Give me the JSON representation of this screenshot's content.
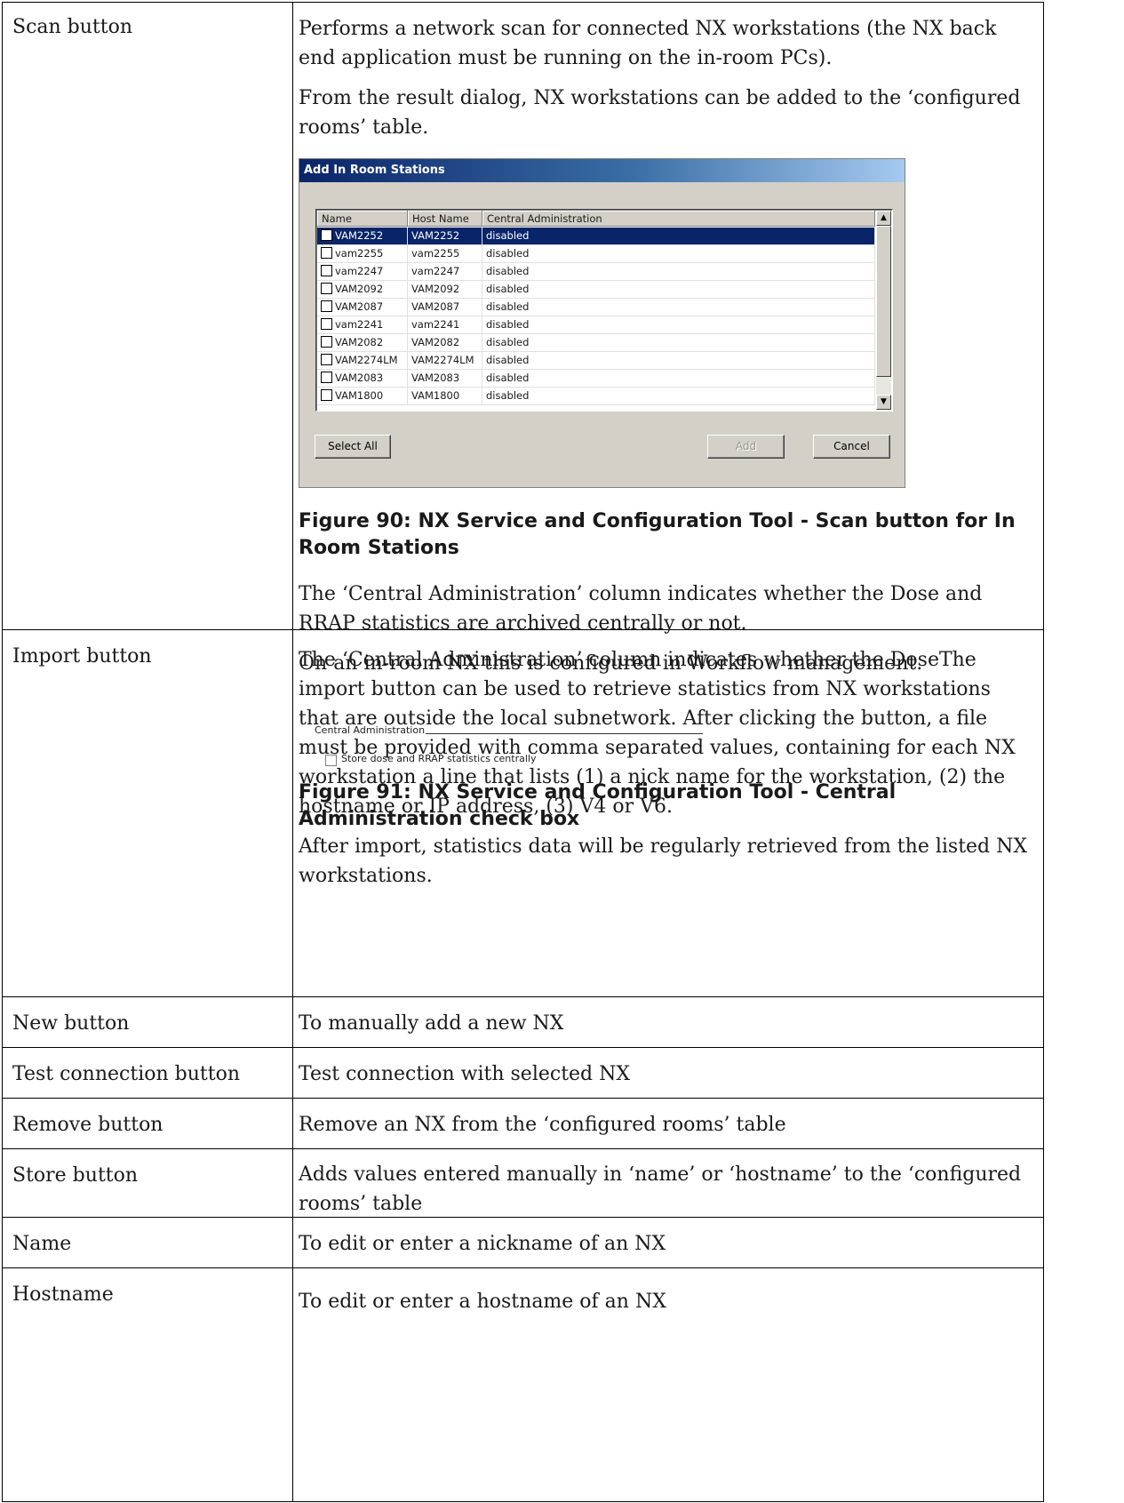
{
  "rows": [
    {
      "label": "Scan button",
      "paragraphs": [
        "Performs a network scan for connected NX workstations (the NX back end application must be running on the in-room PCs).",
        "From the result dialog, NX workstations can be added to the ‘configured rooms’ table."
      ],
      "dialog": {
        "title": "Add In Room Stations",
        "columns": [
          "Name",
          "Host Name",
          "Central Administration"
        ],
        "stations": [
          {
            "name": "VAM2252",
            "host": "VAM2252",
            "central": "disabled"
          },
          {
            "name": "vam2255",
            "host": "vam2255",
            "central": "disabled"
          },
          {
            "name": "vam2247",
            "host": "vam2247",
            "central": "disabled"
          },
          {
            "name": "VAM2092",
            "host": "VAM2092",
            "central": "disabled"
          },
          {
            "name": "VAM2087",
            "host": "VAM2087",
            "central": "disabled"
          },
          {
            "name": "vam2241",
            "host": "vam2241",
            "central": "disabled"
          },
          {
            "name": "VAM2082",
            "host": "VAM2082",
            "central": "disabled"
          },
          {
            "name": "VAM2274LM",
            "host": "VAM2274LM",
            "central": "disabled"
          },
          {
            "name": "VAM2083",
            "host": "VAM2083",
            "central": "disabled"
          },
          {
            "name": "VAM1800",
            "host": "VAM1800",
            "central": "disabled"
          }
        ],
        "selected_index": 0,
        "buttons": {
          "select_all": "Select All",
          "add": "Add",
          "cancel": "Cancel"
        }
      },
      "figure90_caption": "Figure 90: NX Service and Configuration Tool - Scan button for In Room Stations",
      "after_paragraphs": [
        "The ‘Central Administration’ column indicates whether the Dose and RRAP statistics are archived centrally or not.",
        "On an in-room NX this is configured in Workflow management."
      ],
      "central_admin": {
        "legend": "Central Administration",
        "checkbox_label": "Store dose and RRAP statistics centrally",
        "checked": false
      },
      "figure91_caption": "Figure 91: NX Service and Configuration Tool - Central Administration check box"
    },
    {
      "label": "Import button",
      "paragraphs": [
        "The ‘Central Administration’ column indicates whether the DoseThe import button can be used to retrieve statistics from NX workstations that are outside the local subnetwork. After clicking the button, a file must be provided with comma separated values, containing for each NX workstation a line that lists (1) a nick name for the workstation, (2) the hostname or IP address, (3) V4 or V6.",
        "After import, statistics data will be regularly retrieved from the listed NX workstations."
      ]
    },
    {
      "label": "New button",
      "description": "To manually add a new NX"
    },
    {
      "label": "Test connection button",
      "description": "Test connection with selected NX"
    },
    {
      "label": "Remove button",
      "description": "Remove an NX from the ‘configured rooms’ table"
    },
    {
      "label": "Store button",
      "description": "Adds values entered manually in ‘name’ or ‘hostname’ to the ‘configured rooms’ table"
    },
    {
      "label": "Name",
      "description": "To edit or enter a nickname of an NX"
    },
    {
      "label": "Hostname",
      "description": "To edit or enter a hostname of an NX"
    }
  ]
}
